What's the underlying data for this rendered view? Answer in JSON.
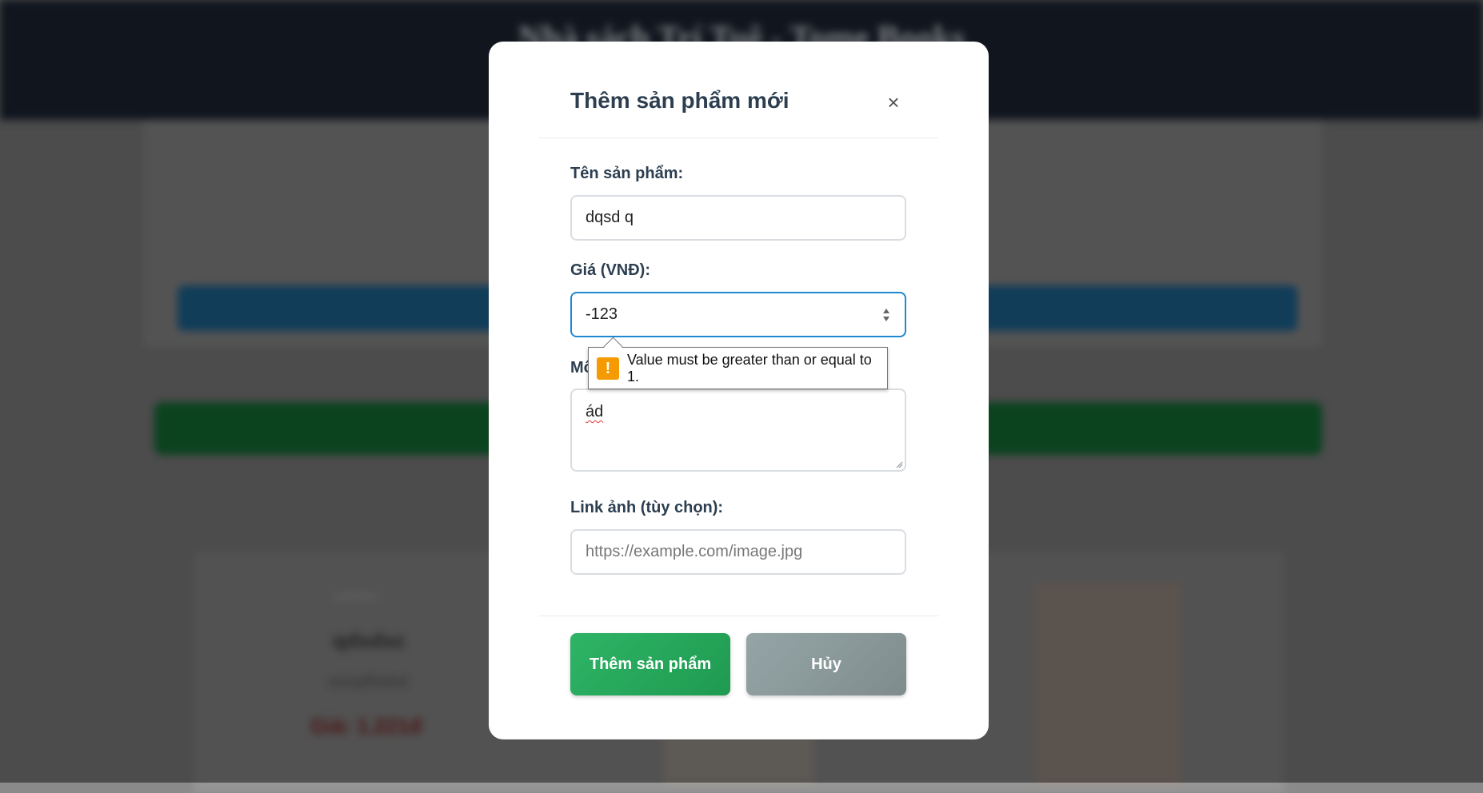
{
  "background": {
    "site_title": "Nhà sách Trí Tuệ - Tome Books",
    "card": {
      "image_alt": "qdsdsc",
      "title": "qdsdsc",
      "description": "sssqdfsdsd",
      "price": "Giá: 1.221đ"
    }
  },
  "modal": {
    "title": "Thêm sản phẩm mới",
    "close_icon": "×",
    "name_label": "Tên sản phẩm:",
    "name_value": "dqsd q",
    "price_label": "Giá (VNĐ):",
    "price_value": "-123",
    "description_label": "Mô",
    "description_value": "ád",
    "image_label": "Link ảnh (tùy chọn):",
    "image_placeholder": "https://example.com/image.jpg",
    "validation_message": "Value must be greater than or equal to 1.",
    "validation_icon": "!",
    "submit_label": "Thêm sản phẩm",
    "cancel_label": "Hủy"
  },
  "colors": {
    "header_dark": "#1e2738",
    "primary_green": "#27ae60",
    "cancel_gray": "#95a5a6",
    "focus_blue": "#1e88d1",
    "warning_orange": "#f59a00"
  }
}
